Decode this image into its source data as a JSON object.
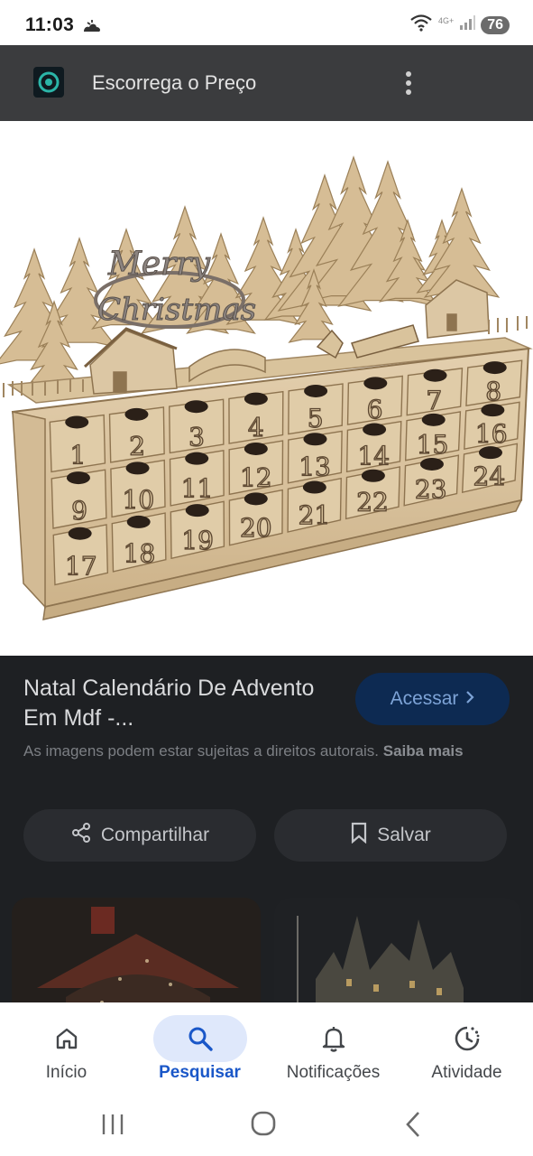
{
  "status_bar": {
    "time": "11:03",
    "network": "4G+",
    "battery": "76"
  },
  "app_bar": {
    "title": "Escorrega o Preço"
  },
  "product": {
    "title": "Natal Calendário De Advento Em Mdf -...",
    "visit_button": "Acessar",
    "rights_notice": "As imagens podem estar sujeitas a direitos autorais.",
    "learn_more": "Saiba mais",
    "share_button": "Compartilhar",
    "save_button": "Salvar"
  },
  "advent_calendar": {
    "greeting_line1": "Merry",
    "greeting_line2": "Christmas",
    "drawer_numbers": [
      "1",
      "2",
      "3",
      "4",
      "5",
      "6",
      "7",
      "8",
      "9",
      "10",
      "11",
      "12",
      "13",
      "14",
      "15",
      "16",
      "17",
      "18",
      "19",
      "20",
      "21",
      "22",
      "23",
      "24"
    ]
  },
  "bottom_nav": [
    {
      "label": "Início",
      "icon": "home-icon"
    },
    {
      "label": "Pesquisar",
      "icon": "search-icon",
      "active": true
    },
    {
      "label": "Notificações",
      "icon": "bell-icon"
    },
    {
      "label": "Atividade",
      "icon": "activity-clock-icon"
    }
  ],
  "colors": {
    "accent": "#1a57c8",
    "wood": "#dcc7a4",
    "appbar": "#3b3c3e",
    "dim_background": "#1e2023"
  }
}
